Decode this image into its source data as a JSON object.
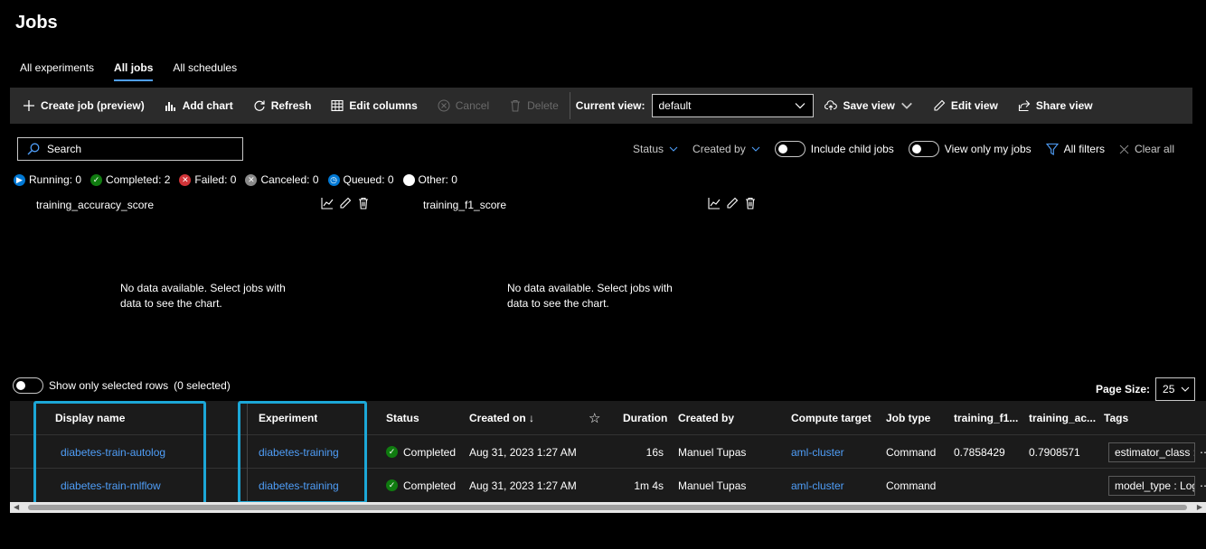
{
  "page": {
    "title": "Jobs"
  },
  "tabs": [
    {
      "label": "All experiments"
    },
    {
      "label": "All jobs"
    },
    {
      "label": "All schedules"
    }
  ],
  "toolbar": {
    "create_job": "Create job (preview)",
    "add_chart": "Add chart",
    "refresh": "Refresh",
    "edit_columns": "Edit columns",
    "cancel": "Cancel",
    "delete": "Delete",
    "current_view_label": "Current view:",
    "current_view_value": "default",
    "save_view": "Save view",
    "edit_view": "Edit view",
    "share_view": "Share view"
  },
  "search": {
    "placeholder": "Search"
  },
  "filters": {
    "status": "Status",
    "created_by": "Created by",
    "include_child_jobs": "Include child jobs",
    "view_only_my_jobs": "View only my jobs",
    "all_filters": "All filters",
    "clear_all": "Clear all"
  },
  "status_counts": {
    "running": "Running: 0",
    "completed": "Completed: 2",
    "failed": "Failed: 0",
    "canceled": "Canceled: 0",
    "queued": "Queued: 0",
    "other": "Other: 0"
  },
  "charts": [
    {
      "title": "training_accuracy_score",
      "message": "No data available. Select jobs with data to see the chart."
    },
    {
      "title": "training_f1_score",
      "message": "No data available. Select jobs with data to see the chart."
    }
  ],
  "selection": {
    "label": "Show only selected rows",
    "count": "(0 selected)"
  },
  "pagination": {
    "label": "Page Size:",
    "value": "25"
  },
  "table": {
    "headers": {
      "display_name": "Display name",
      "experiment": "Experiment",
      "status": "Status",
      "created_on": "Created on ↓",
      "duration": "Duration",
      "created_by": "Created by",
      "compute_target": "Compute target",
      "job_type": "Job type",
      "training_f1": "training_f1...",
      "training_ac": "training_ac...",
      "tags": "Tags"
    },
    "rows": [
      {
        "display_name": "diabetes-train-autolog",
        "experiment": "diabetes-training",
        "status": "Completed",
        "created_on": "Aug 31, 2023 1:27 AM",
        "duration": "16s",
        "created_by": "Manuel Tupas",
        "compute_target": "aml-cluster",
        "job_type": "Command",
        "training_f1": "0.7858429",
        "training_ac": "0.7908571",
        "tag": "estimator_class : s"
      },
      {
        "display_name": "diabetes-train-mlflow",
        "experiment": "diabetes-training",
        "status": "Completed",
        "created_on": "Aug 31, 2023 1:27 AM",
        "duration": "1m 4s",
        "created_by": "Manuel Tupas",
        "compute_target": "aml-cluster",
        "job_type": "Command",
        "training_f1": "",
        "training_ac": "",
        "tag": "model_type : Logi"
      }
    ]
  },
  "colors": {
    "accent": "#4f9ef8",
    "highlight": "#1ca7d7",
    "completed": "#107c10",
    "failed": "#d13438",
    "canceled": "#8a8a8a",
    "running": "#0078d4"
  }
}
